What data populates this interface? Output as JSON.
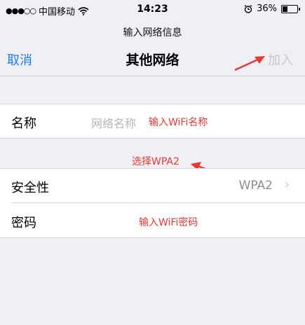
{
  "status_bar": {
    "carrier": "中国移动",
    "time": "14:23",
    "battery_percent": "36%",
    "battery_level": 0.36
  },
  "screen": {
    "subtitle": "输入网络信息"
  },
  "navbar": {
    "cancel_label": "取消",
    "title": "其他网络",
    "join_label": "加入"
  },
  "form": {
    "name_label": "名称",
    "name_placeholder": "网络名称",
    "security_label": "安全性",
    "security_value": "WPA2",
    "password_label": "密码"
  },
  "annotations": {
    "name_hint": "输入WiFi名称",
    "security_hint": "选择WPA2",
    "password_hint": "输入WiFi密码",
    "color": "#e53935"
  },
  "colors": {
    "accent": "#1a7cf5",
    "disabled": "#c8c8cc",
    "background": "#efeff4"
  }
}
